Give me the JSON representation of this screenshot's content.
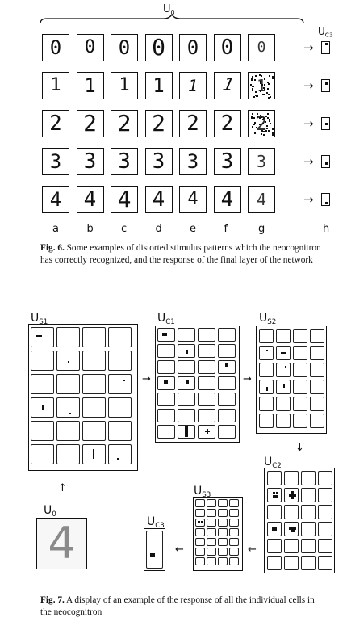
{
  "fig6": {
    "u0_label": "U",
    "u0_sub": "0",
    "uc3_label": "U",
    "uc3_sub": "C3",
    "rows": [
      {
        "digit": "0",
        "sizes": [
          24,
          22,
          24,
          28,
          24,
          26,
          18
        ]
      },
      {
        "digit": "1",
        "sizes": [
          22,
          24,
          22,
          24,
          20,
          22,
          0
        ]
      },
      {
        "digit": "2",
        "sizes": [
          26,
          28,
          28,
          28,
          26,
          26,
          24
        ]
      },
      {
        "digit": "3",
        "sizes": [
          24,
          26,
          26,
          26,
          24,
          26,
          20
        ]
      },
      {
        "digit": "4",
        "sizes": [
          24,
          26,
          28,
          26,
          22,
          26,
          20
        ]
      }
    ],
    "columns": [
      "a",
      "b",
      "c",
      "d",
      "e",
      "f",
      "g",
      "h"
    ],
    "arrow": "→",
    "caption_bold": "Fig. 6.",
    "caption_text": " Some examples of distorted stimulus patterns which the neocognitron has correctly recognized, and the response of the final layer of the network"
  },
  "fig7": {
    "us1": {
      "label": "U",
      "sub": "S1"
    },
    "uc1": {
      "label": "U",
      "sub": "C1"
    },
    "us2": {
      "label": "U",
      "sub": "S2"
    },
    "uc2": {
      "label": "U",
      "sub": "C2"
    },
    "us3": {
      "label": "U",
      "sub": "S3"
    },
    "uc3": {
      "label": "U",
      "sub": "C3"
    },
    "u0": {
      "label": "U",
      "sub": "0",
      "digit": "4"
    },
    "arrow_right": "→",
    "arrow_left": "←",
    "arrow_down": "↓",
    "arrow_up": "↑",
    "caption_bold": "Fig. 7.",
    "caption_text": " A display of an example of the response of all the individual cells in the neocognitron"
  }
}
